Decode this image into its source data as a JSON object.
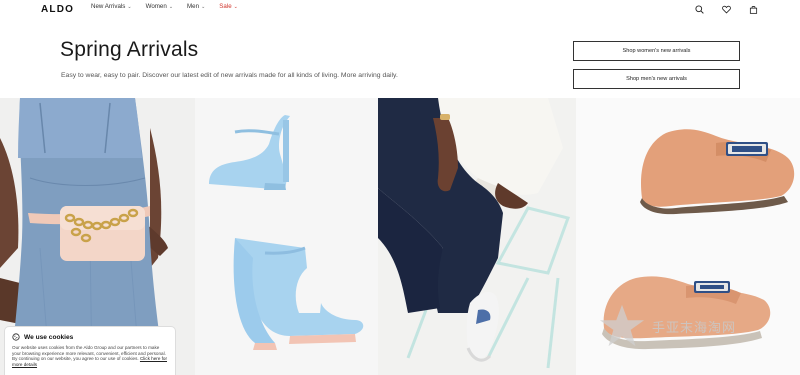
{
  "header": {
    "logo": "ALDO",
    "nav": [
      {
        "label": "New Arrivals",
        "has_menu": true
      },
      {
        "label": "Women",
        "has_menu": true
      },
      {
        "label": "Men",
        "has_menu": true
      },
      {
        "label": "Sale",
        "has_menu": true
      }
    ],
    "icons": [
      "search-icon",
      "heart-icon",
      "bag-icon"
    ]
  },
  "hero": {
    "title": "Spring Arrivals",
    "subtitle": "Easy to wear, easy to pair. Discover our latest edit of new arrivals made for all kinds of living. More arriving daily.",
    "cta_women": "Shop women's new arrivals",
    "cta_men": "Shop men's new arrivals"
  },
  "cookie": {
    "title": "We use cookies",
    "body": "Our website uses cookies from the Aldo Group and our partners to make your browsing experience more relevant, convenient, efficient and personal. By continuing on our website, you agree to our use of cookies.",
    "link": "Click here for more details"
  },
  "watermark": {
    "text": "手亚末海淘网"
  },
  "colors": {
    "sale": "#d0342c",
    "denim": "#7f9ec0",
    "shoe_blue": "#a9d4f0",
    "loafer": "#e3a07a"
  }
}
